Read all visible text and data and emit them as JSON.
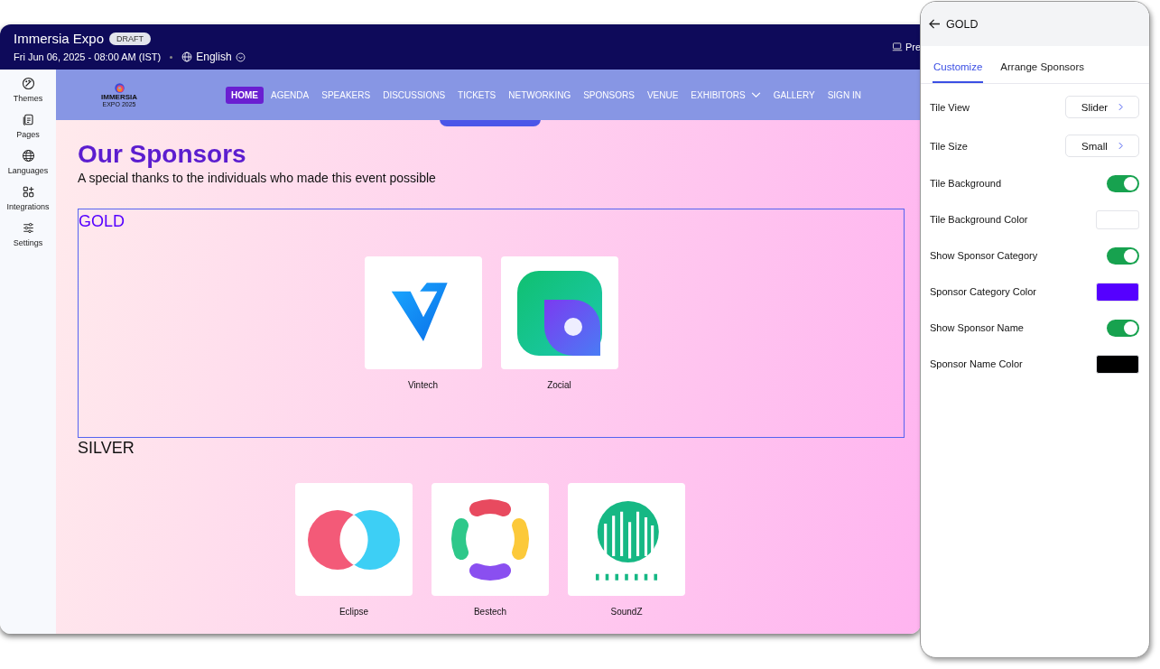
{
  "app": {
    "title": "Immersia Expo",
    "badge": "DRAFT",
    "date": "Fri Jun 06, 2025 - 08:00 AM (IST)",
    "language": "English",
    "preview": "Pre"
  },
  "sidebar": {
    "items": [
      {
        "kind": "palette",
        "label": "Themes"
      },
      {
        "kind": "pages",
        "label": "Pages"
      },
      {
        "kind": "globe",
        "label": "Languages"
      },
      {
        "kind": "grid",
        "label": "Integrations"
      },
      {
        "kind": "sliders",
        "label": "Settings"
      }
    ]
  },
  "site_nav": {
    "logo": {
      "name": "IMMERSIA",
      "subtitle": "EXPO 2025"
    },
    "items": [
      {
        "label": "HOME",
        "selected": true,
        "dropdown": false
      },
      {
        "label": "AGENDA",
        "selected": false,
        "dropdown": false
      },
      {
        "label": "SPEAKERS",
        "selected": false,
        "dropdown": false
      },
      {
        "label": "DISCUSSIONS",
        "selected": false,
        "dropdown": false
      },
      {
        "label": "TICKETS",
        "selected": false,
        "dropdown": false
      },
      {
        "label": "NETWORKING",
        "selected": false,
        "dropdown": false
      },
      {
        "label": "SPONSORS",
        "selected": false,
        "dropdown": false
      },
      {
        "label": "VENUE",
        "selected": false,
        "dropdown": false
      },
      {
        "label": "EXHIBITORS",
        "selected": false,
        "dropdown": true
      },
      {
        "label": "GALLERY",
        "selected": false,
        "dropdown": false
      },
      {
        "label": "SIGN IN",
        "selected": false,
        "dropdown": false
      }
    ]
  },
  "content": {
    "heading": "Our Sponsors",
    "subtitle": "A special thanks to the individuals who made this event possible",
    "categories": [
      {
        "name": "GOLD",
        "selected": true,
        "sponsors": [
          {
            "name": "Vintech",
            "kind": "chevron"
          },
          {
            "name": "Zocial",
            "kind": "leaf"
          }
        ]
      },
      {
        "name": "SILVER",
        "selected": false,
        "sponsors": [
          {
            "name": "Eclipse",
            "kind": "circles"
          },
          {
            "name": "Bestech",
            "kind": "ring"
          },
          {
            "name": "SoundZ",
            "kind": "bars"
          }
        ]
      }
    ]
  },
  "panel": {
    "title": "GOLD",
    "tabs": [
      {
        "label": "Customize",
        "selected": true
      },
      {
        "label": "Arrange Sponsors",
        "selected": false
      }
    ],
    "settings": [
      {
        "kind": "select",
        "label": "Tile View",
        "value": "Slider"
      },
      {
        "kind": "select",
        "label": "Tile Size",
        "value": "Small"
      },
      {
        "kind": "toggle",
        "label": "Tile Background",
        "on": true
      },
      {
        "kind": "color",
        "label": "Tile Background Color",
        "color": "#ffffff"
      },
      {
        "kind": "toggle",
        "label": "Show Sponsor Category",
        "on": true
      },
      {
        "kind": "color",
        "label": "Sponsor Category Color",
        "color": "#5500ff"
      },
      {
        "kind": "toggle",
        "label": "Show Sponsor Name",
        "on": true
      },
      {
        "kind": "color",
        "label": "Sponsor Name Color",
        "color": "#000000"
      }
    ]
  }
}
